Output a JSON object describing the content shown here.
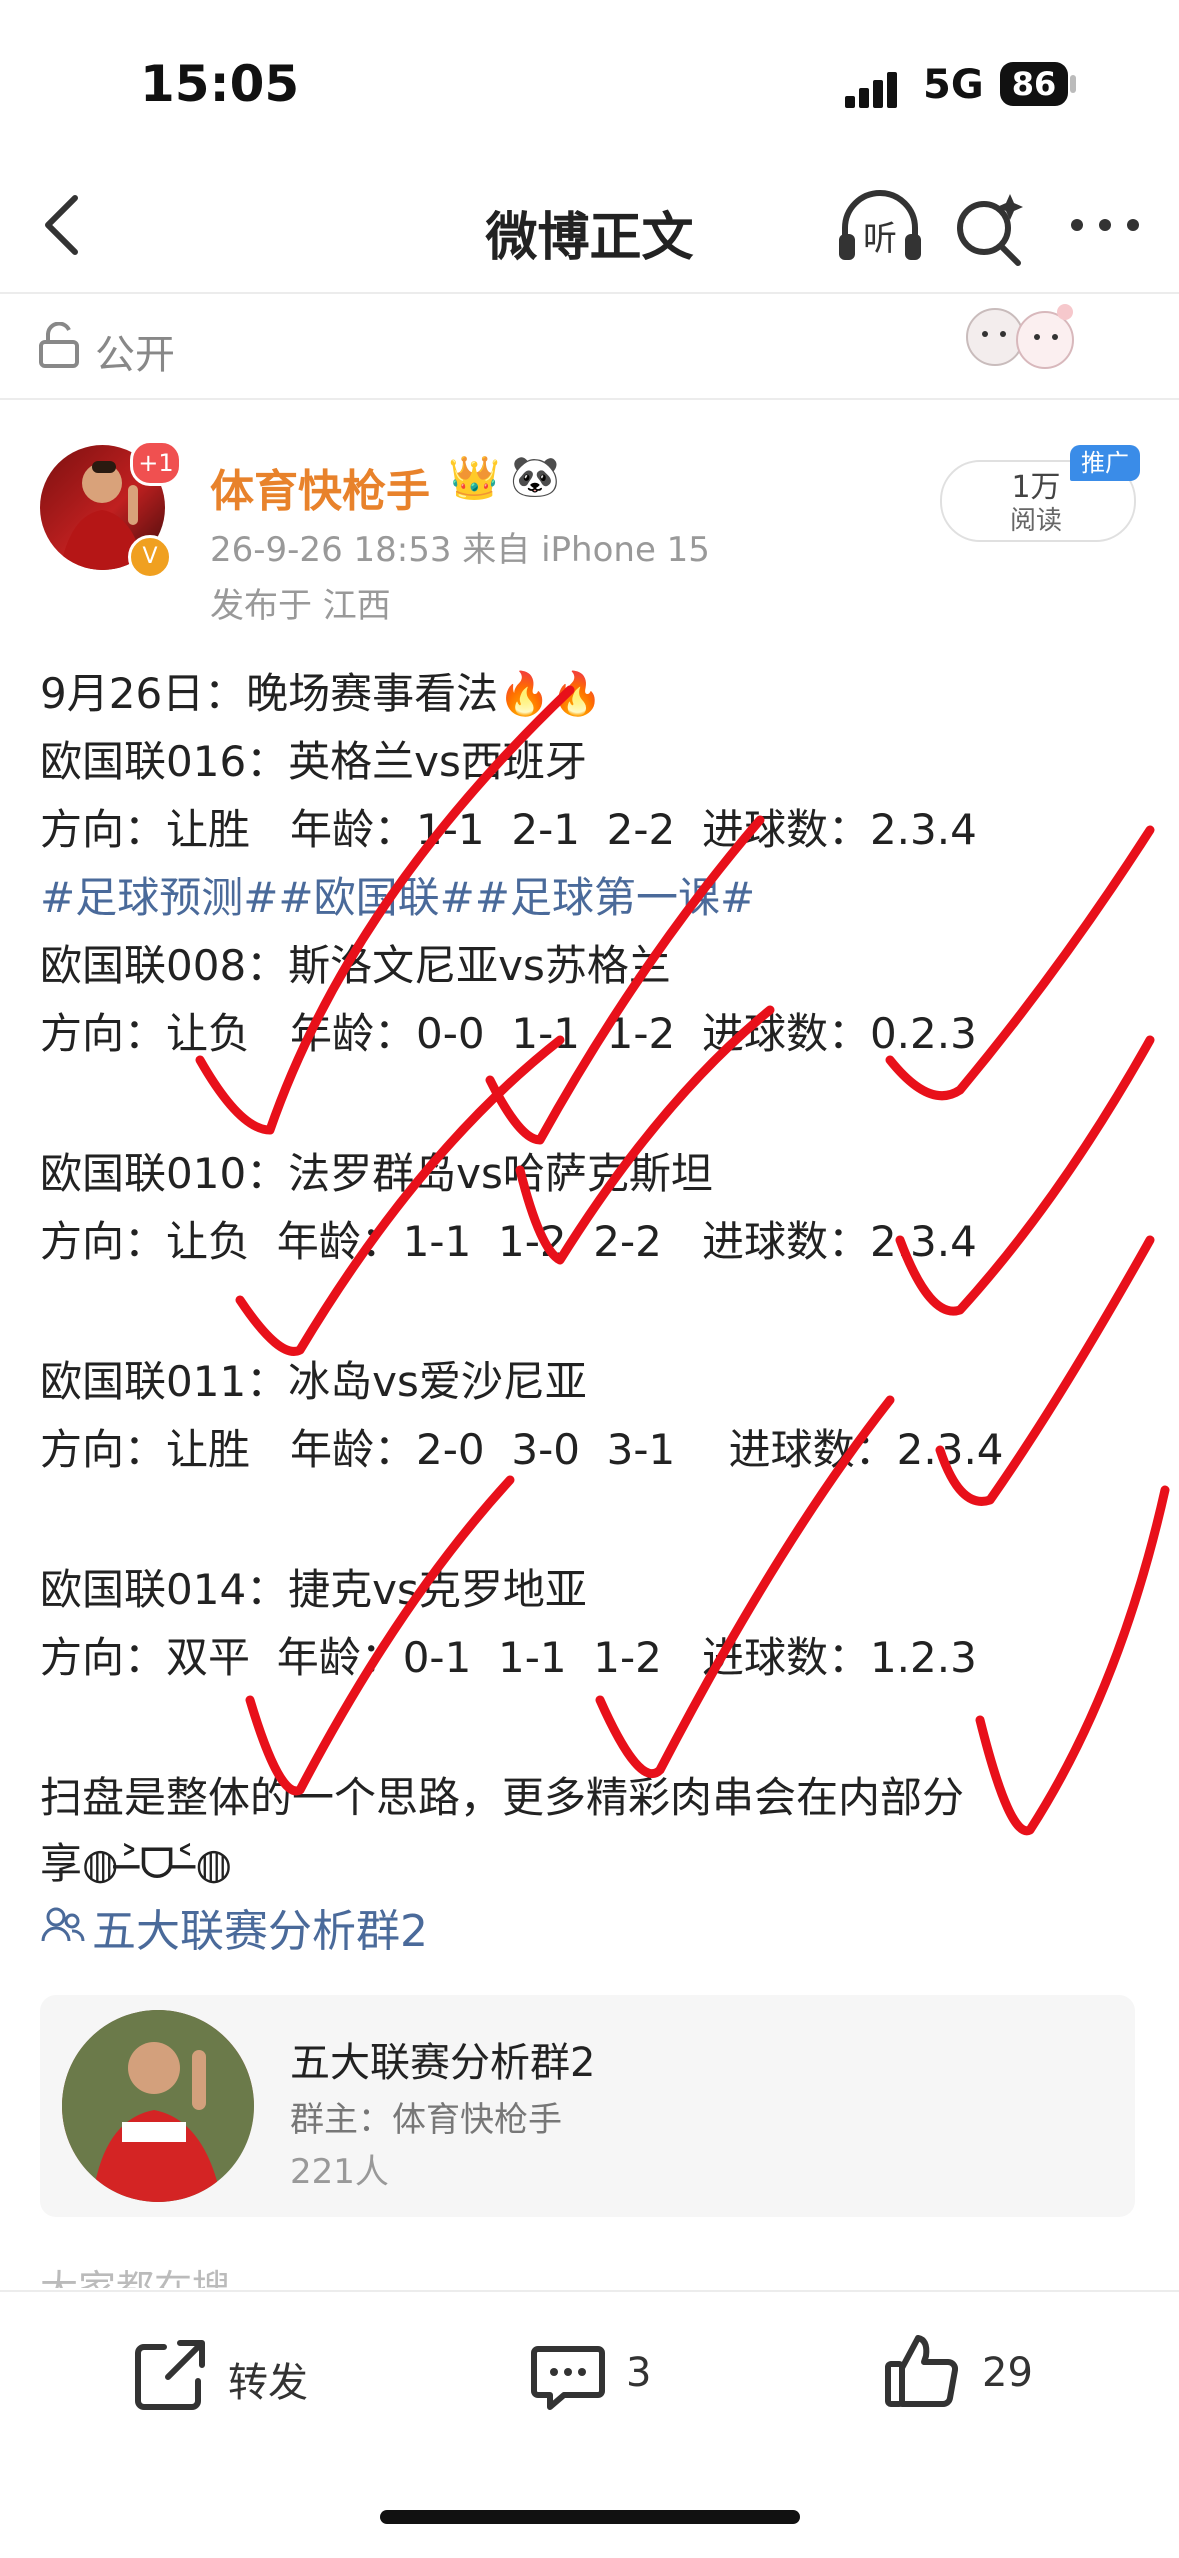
{
  "status_bar": {
    "time": "15:05",
    "network": "5G",
    "battery": "86"
  },
  "nav": {
    "title": "微博正文",
    "listen_label": "听"
  },
  "visibility": {
    "label": "公开"
  },
  "author": {
    "avatar_badge": "+1",
    "name": "体育快枪手",
    "timestamp_source": "26-9-26 18:53  来自 iPhone 15",
    "location": "发布于 江西",
    "reads": "1万",
    "reads_label": "阅读",
    "promo_tag": "推广"
  },
  "post": {
    "lines": [
      "9月26日：晚场赛事看法🔥🔥",
      "欧国联016：英格兰vs西班牙",
      "方向：让胜   年龄：1-1  2-1  2-2  进球数：2.3.4",
      "#足球预测##欧国联##足球第一课#",
      "欧国联008：斯洛文尼亚vs苏格兰",
      "方向：让负   年龄：0-0  1-1  1-2  进球数：0.2.3",
      "欧国联010：法罗群岛vs哈萨克斯坦",
      "方向：让负  年龄：1-1  1-2  2-2   进球数：2.3.4",
      "欧国联011：冰岛vs爱沙尼亚",
      "方向：让胜   年龄：2-0  3-0  3-1    进球数：2.3.4",
      "欧国联014：捷克vs克罗地亚",
      "方向：双平  年龄：0-1  1-1  1-2   进球数：1.2.3",
      "扫盘是整体的一个思路，更多精彩肉串会在内部分",
      "享◍˃̶ᗜ˂̶◍"
    ],
    "group_link": "五大联赛分析群2"
  },
  "group_card": {
    "name": "五大联赛分析群2",
    "owner": "群主：体育快枪手",
    "members": "221人"
  },
  "search_hint": "大家都在搜",
  "bottom_bar": {
    "repost_label": "转发",
    "comments": "3",
    "likes": "29"
  },
  "colors": {
    "accent_orange": "#e8822b",
    "link_blue": "#4a6a9a",
    "check_red": "#e8101a"
  }
}
